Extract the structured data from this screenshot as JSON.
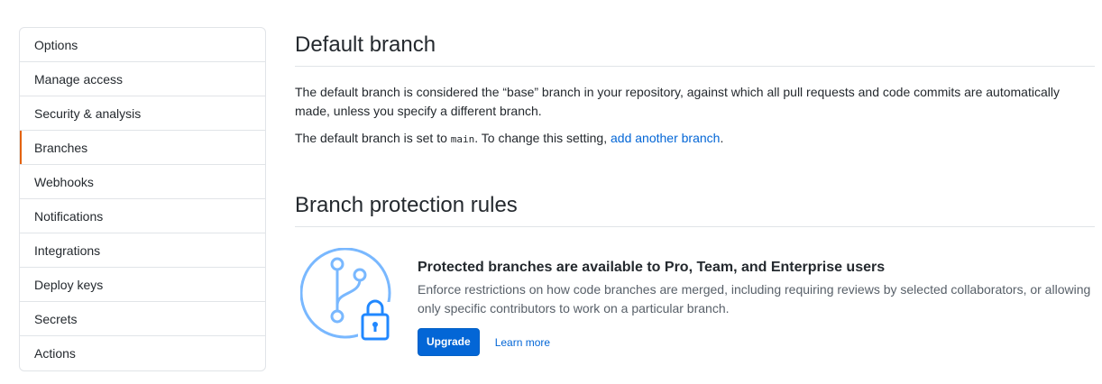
{
  "sidebar": {
    "items": [
      {
        "label": "Options"
      },
      {
        "label": "Manage access"
      },
      {
        "label": "Security & analysis"
      },
      {
        "label": "Branches",
        "selected": true
      },
      {
        "label": "Webhooks"
      },
      {
        "label": "Notifications"
      },
      {
        "label": "Integrations"
      },
      {
        "label": "Deploy keys"
      },
      {
        "label": "Secrets"
      },
      {
        "label": "Actions"
      }
    ]
  },
  "default_branch": {
    "title": "Default branch",
    "description": "The default branch is considered the “base” branch in your repository, against which all pull requests and code commits are automatically made, unless you specify a different branch.",
    "set_prefix": "The default branch is set to ",
    "branch_name": "main",
    "set_middle": ". To change this setting, ",
    "link_label": "add another branch",
    "set_suffix": "."
  },
  "protection": {
    "title": "Branch protection rules",
    "heading": "Protected branches are available to Pro, Team, and Enterprise users",
    "description": "Enforce restrictions on how code branches are merged, including requiring reviews by selected collaborators, or allowing only specific contributors to work on a particular branch.",
    "upgrade_label": "Upgrade",
    "learn_more_label": "Learn more"
  },
  "colors": {
    "accent_selected": "#e36209",
    "link": "#0366d6",
    "illustration": "#79b8ff",
    "illustration_dark": "#2188ff"
  },
  "icons": [
    "branch-lock-illustration"
  ]
}
